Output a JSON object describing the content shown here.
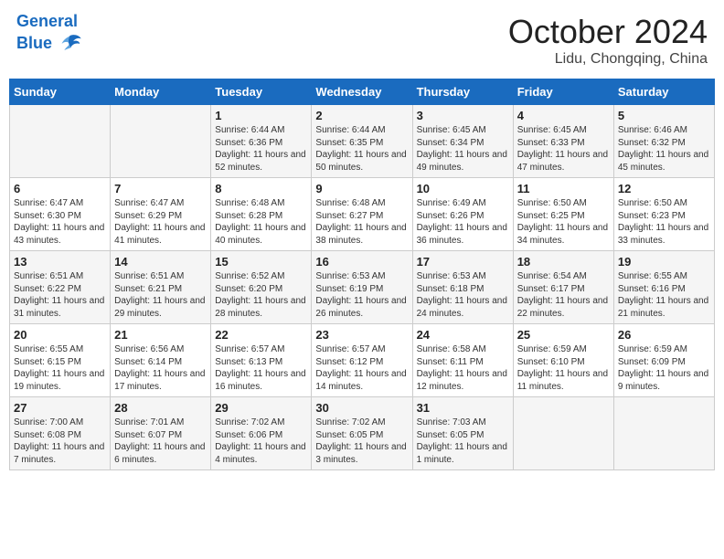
{
  "header": {
    "logo_line1": "General",
    "logo_line2": "Blue",
    "month": "October 2024",
    "location": "Lidu, Chongqing, China"
  },
  "days_of_week": [
    "Sunday",
    "Monday",
    "Tuesday",
    "Wednesday",
    "Thursday",
    "Friday",
    "Saturday"
  ],
  "weeks": [
    [
      {
        "day": "",
        "info": ""
      },
      {
        "day": "",
        "info": ""
      },
      {
        "day": "1",
        "info": "Sunrise: 6:44 AM\nSunset: 6:36 PM\nDaylight: 11 hours and 52 minutes."
      },
      {
        "day": "2",
        "info": "Sunrise: 6:44 AM\nSunset: 6:35 PM\nDaylight: 11 hours and 50 minutes."
      },
      {
        "day": "3",
        "info": "Sunrise: 6:45 AM\nSunset: 6:34 PM\nDaylight: 11 hours and 49 minutes."
      },
      {
        "day": "4",
        "info": "Sunrise: 6:45 AM\nSunset: 6:33 PM\nDaylight: 11 hours and 47 minutes."
      },
      {
        "day": "5",
        "info": "Sunrise: 6:46 AM\nSunset: 6:32 PM\nDaylight: 11 hours and 45 minutes."
      }
    ],
    [
      {
        "day": "6",
        "info": "Sunrise: 6:47 AM\nSunset: 6:30 PM\nDaylight: 11 hours and 43 minutes."
      },
      {
        "day": "7",
        "info": "Sunrise: 6:47 AM\nSunset: 6:29 PM\nDaylight: 11 hours and 41 minutes."
      },
      {
        "day": "8",
        "info": "Sunrise: 6:48 AM\nSunset: 6:28 PM\nDaylight: 11 hours and 40 minutes."
      },
      {
        "day": "9",
        "info": "Sunrise: 6:48 AM\nSunset: 6:27 PM\nDaylight: 11 hours and 38 minutes."
      },
      {
        "day": "10",
        "info": "Sunrise: 6:49 AM\nSunset: 6:26 PM\nDaylight: 11 hours and 36 minutes."
      },
      {
        "day": "11",
        "info": "Sunrise: 6:50 AM\nSunset: 6:25 PM\nDaylight: 11 hours and 34 minutes."
      },
      {
        "day": "12",
        "info": "Sunrise: 6:50 AM\nSunset: 6:23 PM\nDaylight: 11 hours and 33 minutes."
      }
    ],
    [
      {
        "day": "13",
        "info": "Sunrise: 6:51 AM\nSunset: 6:22 PM\nDaylight: 11 hours and 31 minutes."
      },
      {
        "day": "14",
        "info": "Sunrise: 6:51 AM\nSunset: 6:21 PM\nDaylight: 11 hours and 29 minutes."
      },
      {
        "day": "15",
        "info": "Sunrise: 6:52 AM\nSunset: 6:20 PM\nDaylight: 11 hours and 28 minutes."
      },
      {
        "day": "16",
        "info": "Sunrise: 6:53 AM\nSunset: 6:19 PM\nDaylight: 11 hours and 26 minutes."
      },
      {
        "day": "17",
        "info": "Sunrise: 6:53 AM\nSunset: 6:18 PM\nDaylight: 11 hours and 24 minutes."
      },
      {
        "day": "18",
        "info": "Sunrise: 6:54 AM\nSunset: 6:17 PM\nDaylight: 11 hours and 22 minutes."
      },
      {
        "day": "19",
        "info": "Sunrise: 6:55 AM\nSunset: 6:16 PM\nDaylight: 11 hours and 21 minutes."
      }
    ],
    [
      {
        "day": "20",
        "info": "Sunrise: 6:55 AM\nSunset: 6:15 PM\nDaylight: 11 hours and 19 minutes."
      },
      {
        "day": "21",
        "info": "Sunrise: 6:56 AM\nSunset: 6:14 PM\nDaylight: 11 hours and 17 minutes."
      },
      {
        "day": "22",
        "info": "Sunrise: 6:57 AM\nSunset: 6:13 PM\nDaylight: 11 hours and 16 minutes."
      },
      {
        "day": "23",
        "info": "Sunrise: 6:57 AM\nSunset: 6:12 PM\nDaylight: 11 hours and 14 minutes."
      },
      {
        "day": "24",
        "info": "Sunrise: 6:58 AM\nSunset: 6:11 PM\nDaylight: 11 hours and 12 minutes."
      },
      {
        "day": "25",
        "info": "Sunrise: 6:59 AM\nSunset: 6:10 PM\nDaylight: 11 hours and 11 minutes."
      },
      {
        "day": "26",
        "info": "Sunrise: 6:59 AM\nSunset: 6:09 PM\nDaylight: 11 hours and 9 minutes."
      }
    ],
    [
      {
        "day": "27",
        "info": "Sunrise: 7:00 AM\nSunset: 6:08 PM\nDaylight: 11 hours and 7 minutes."
      },
      {
        "day": "28",
        "info": "Sunrise: 7:01 AM\nSunset: 6:07 PM\nDaylight: 11 hours and 6 minutes."
      },
      {
        "day": "29",
        "info": "Sunrise: 7:02 AM\nSunset: 6:06 PM\nDaylight: 11 hours and 4 minutes."
      },
      {
        "day": "30",
        "info": "Sunrise: 7:02 AM\nSunset: 6:05 PM\nDaylight: 11 hours and 3 minutes."
      },
      {
        "day": "31",
        "info": "Sunrise: 7:03 AM\nSunset: 6:05 PM\nDaylight: 11 hours and 1 minute."
      },
      {
        "day": "",
        "info": ""
      },
      {
        "day": "",
        "info": ""
      }
    ]
  ]
}
